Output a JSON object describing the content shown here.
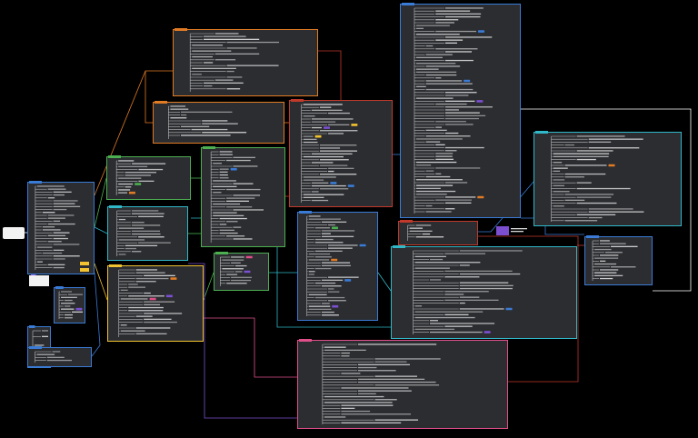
{
  "root": {
    "label": ""
  },
  "colors": {
    "background": "#000000",
    "panel": "#2b2d31",
    "text": "#d8d8d8",
    "orange": "#e07b24",
    "yellow": "#f2c230",
    "green": "#4caf50",
    "blue": "#3a7bd5",
    "cyan": "#2fb8c8",
    "pink": "#e04f8a",
    "purple": "#7b4fd0",
    "red": "#c0392b",
    "white": "#ffffff"
  },
  "topics": [
    {
      "id": "topic-a",
      "border": "blue"
    },
    {
      "id": "topic-b",
      "border": "blue"
    },
    {
      "id": "topic-c",
      "border": "orange"
    },
    {
      "id": "topic-d",
      "border": "orange"
    },
    {
      "id": "topic-e",
      "border": "green"
    },
    {
      "id": "topic-f",
      "border": "cyan"
    },
    {
      "id": "topic-g",
      "border": "yellow"
    },
    {
      "id": "topic-h",
      "border": "green"
    },
    {
      "id": "topic-i",
      "border": "green"
    },
    {
      "id": "topic-j",
      "border": "red"
    },
    {
      "id": "topic-k",
      "border": "blue"
    },
    {
      "id": "topic-l",
      "border": "cyan"
    },
    {
      "id": "topic-m",
      "border": "blue"
    },
    {
      "id": "topic-n",
      "border": "red"
    },
    {
      "id": "topic-o",
      "border": "cyan"
    },
    {
      "id": "topic-p",
      "border": "blue"
    },
    {
      "id": "topic-q",
      "border": "pink"
    },
    {
      "id": "topic-r",
      "border": "blue"
    },
    {
      "id": "topic-s",
      "border": "blue"
    },
    {
      "id": "topic-t",
      "border": "purple"
    }
  ]
}
